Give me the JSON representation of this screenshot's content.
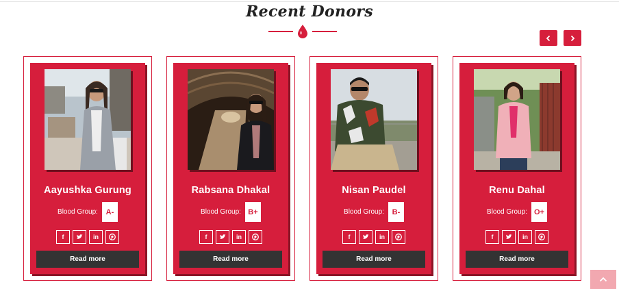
{
  "section": {
    "title": "Recent Donors"
  },
  "carousel": {
    "prev_icon": "chevron-left-icon",
    "next_icon": "chevron-right-icon"
  },
  "labels": {
    "blood_group": "Blood Group:",
    "read_more": "Read more"
  },
  "social_icons": [
    "facebook-icon",
    "twitter-icon",
    "linkedin-icon",
    "pinterest-icon"
  ],
  "donors": [
    {
      "name": "Aayushka Gurung",
      "blood_group": "A-"
    },
    {
      "name": "Rabsana Dhakal",
      "blood_group": "B+"
    },
    {
      "name": "Nisan Paudel",
      "blood_group": "B-"
    },
    {
      "name": "Renu Dahal",
      "blood_group": "O+"
    }
  ],
  "colors": {
    "accent": "#d61e3c",
    "button_dark": "#333333",
    "back_to_top": "#f2a8b0"
  }
}
